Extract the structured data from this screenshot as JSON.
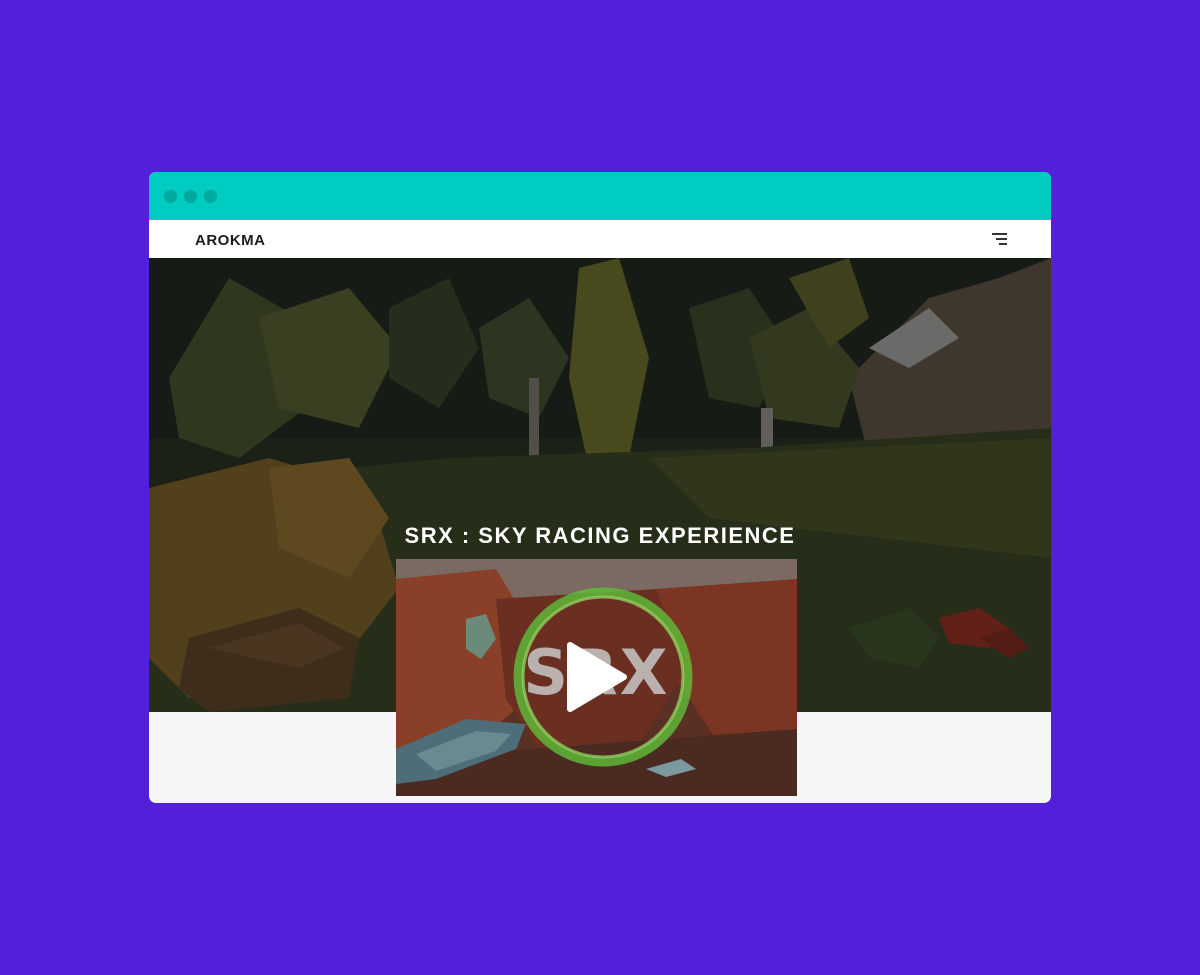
{
  "browser": {
    "controls": [
      "dot",
      "dot",
      "dot"
    ]
  },
  "navbar": {
    "brand": "AROKMA",
    "menu_icon": "hamburger-menu-icon"
  },
  "hero": {
    "title": "SRX : SKY RACING EXPERIENCE"
  },
  "video": {
    "logo_text": "SRX",
    "play_icon": "play-icon"
  },
  "colors": {
    "background": "#5220d8",
    "titlebar": "#00cbc0",
    "titlebar_dots": "#00a99f",
    "navbar": "#ffffff",
    "page": "#f6f6f6"
  }
}
